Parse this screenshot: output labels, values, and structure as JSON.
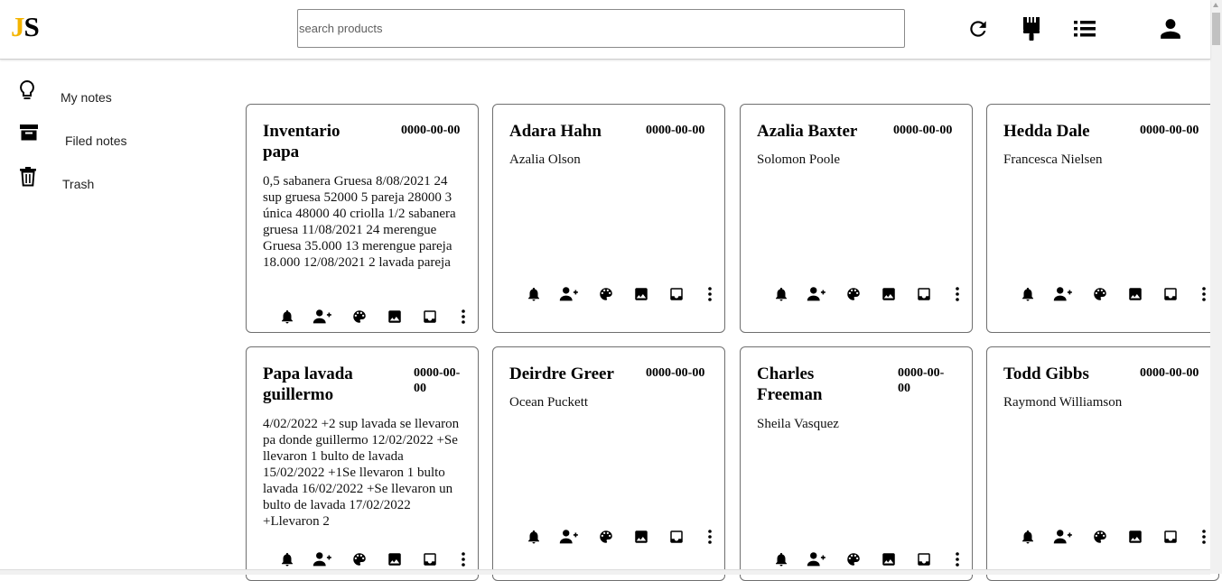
{
  "header": {
    "logo": {
      "first": "J",
      "second": "S"
    },
    "search": {
      "placeholder": "search products",
      "value": ""
    },
    "icons": [
      "refresh-icon",
      "brush-icon",
      "list-view-icon",
      "account-icon"
    ]
  },
  "sidebar": {
    "items": [
      {
        "label": "My notes",
        "icon": "lightbulb-icon"
      },
      {
        "label": "Filed notes",
        "icon": "archive-icon"
      },
      {
        "label": "Trash",
        "icon": "trash-icon"
      }
    ]
  },
  "notes": [
    {
      "title": "Inventario papa",
      "date": "0000-00-00",
      "body": "0,5 sabanera Gruesa 8/08/2021 24 sup gruesa 52000 5 pareja 28000 3 única 48000 40 criolla 1/2 sabanera gruesa 11/08/2021 24 merengue Gruesa 35.000 13 merengue pareja 18.000 12/08/2021 2 lavada pareja"
    },
    {
      "title": "Adara Hahn",
      "date": "0000-00-00",
      "body": "Azalia Olson"
    },
    {
      "title": "Azalia Baxter",
      "date": "0000-00-00",
      "body": "Solomon Poole"
    },
    {
      "title": "Hedda Dale",
      "date": "0000-00-00",
      "body": "Francesca Nielsen"
    },
    {
      "title": "Papa lavada guillermo",
      "date": "0000-00-00",
      "body": "4/02/2022 +2 sup lavada se llevaron pa donde guillermo 12/02/2022 +Se llevaron 1 bulto de lavada 15/02/2022 +1Se llevaron 1 bulto lavada 16/02/2022 +Se llevaron un bulto de lavada 17/02/2022 +Llevaron 2"
    },
    {
      "title": "Deirdre Greer",
      "date": "0000-00-00",
      "body": "Ocean Puckett"
    },
    {
      "title": "Charles Freeman",
      "date": "0000-00-00",
      "body": "Sheila Vasquez"
    },
    {
      "title": "Todd Gibbs",
      "date": "0000-00-00",
      "body": "Raymond Williamson"
    }
  ],
  "note_action_icons": [
    "bell-icon",
    "add-collaborator-icon",
    "palette-icon",
    "image-icon",
    "archive-icon",
    "more-vert-icon"
  ]
}
